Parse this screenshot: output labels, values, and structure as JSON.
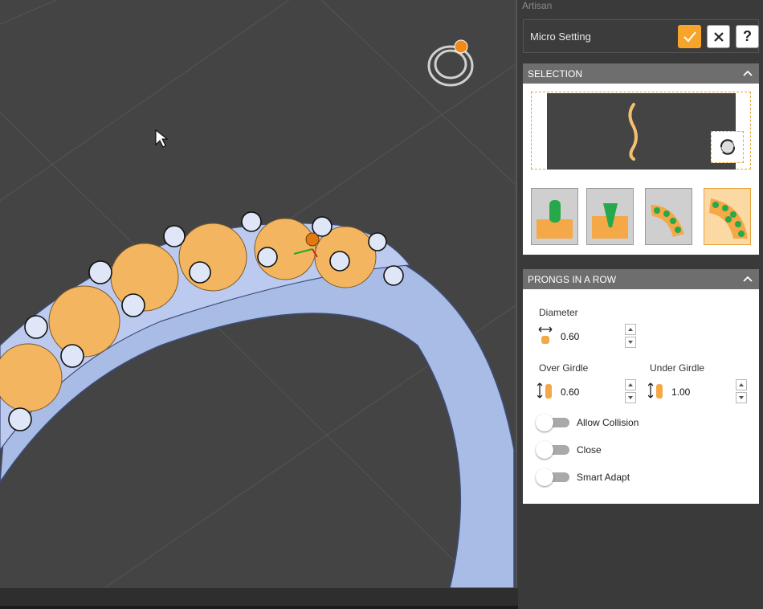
{
  "app": {
    "title": "Artisan"
  },
  "tool": {
    "name": "Micro Setting",
    "ok_icon": "checkmark-icon",
    "cancel_icon": "close-icon",
    "help_label": "?"
  },
  "selection": {
    "title": "SELECTION",
    "modes": [
      "prong-mode",
      "cone-mode",
      "bezel-row-mode",
      "pave-mode"
    ],
    "selected_mode": "pave-mode"
  },
  "prongs": {
    "title": "PRONGS IN A ROW",
    "diameter_label": "Diameter",
    "diameter_value": "0.60",
    "over_label": "Over Girdle",
    "over_value": "0.60",
    "under_label": "Under Girdle",
    "under_value": "1.00",
    "toggles": [
      {
        "label": "Allow Collision",
        "on": false
      },
      {
        "label": "Close",
        "on": false
      },
      {
        "label": "Smart Adapt",
        "on": false
      }
    ]
  },
  "colors": {
    "accent": "#f7a42b",
    "viewport_bg": "#444444",
    "panel_bg": "#3a3a3a",
    "header_bg": "#6e6e6e",
    "metal": "#a9bce6",
    "gem": "#f4b561"
  }
}
